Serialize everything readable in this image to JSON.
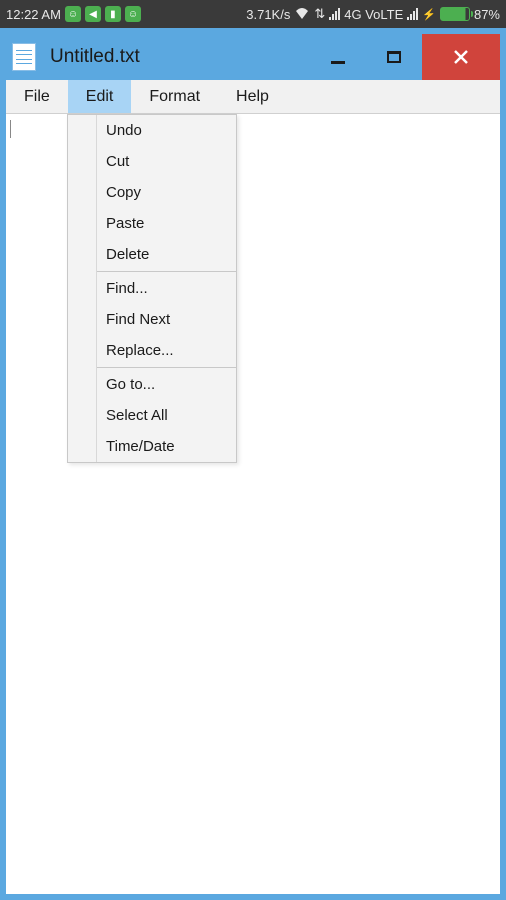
{
  "statusbar": {
    "time": "12:22 AM",
    "speed": "3.71K/s",
    "network": "4G VoLTE",
    "battery_pct": "87%"
  },
  "window": {
    "title": "Untitled.txt"
  },
  "menubar": {
    "file": "File",
    "edit": "Edit",
    "format": "Format",
    "help": "Help"
  },
  "edit_menu": {
    "undo": "Undo",
    "cut": "Cut",
    "copy": "Copy",
    "paste": "Paste",
    "delete": "Delete",
    "find": "Find...",
    "find_next": "Find Next",
    "replace": "Replace...",
    "goto": "Go to...",
    "select_all": "Select All",
    "time_date": "Time/Date"
  }
}
